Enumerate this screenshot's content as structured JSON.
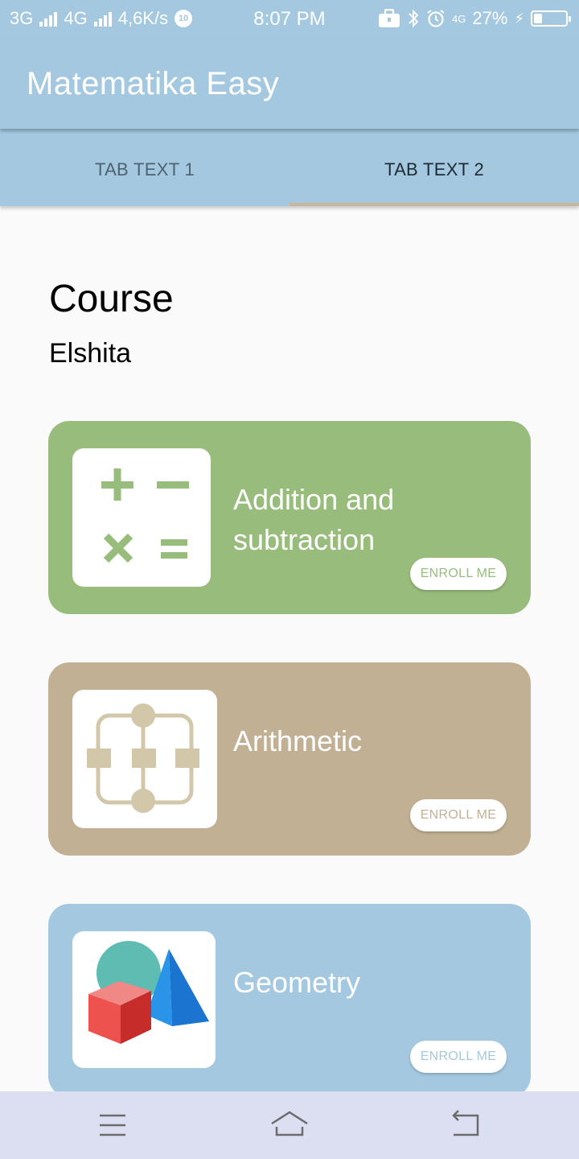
{
  "status_bar": {
    "network1": "3G",
    "network2": "4G",
    "speed": "4,6K/s",
    "notif_badge": "10",
    "time": "8:07 PM",
    "lte": "4G",
    "battery_pct": "27%",
    "battery_level": 0.27
  },
  "app_bar": {
    "title": "Matematika Easy"
  },
  "tabs": [
    {
      "label": "TAB TEXT 1",
      "active": false
    },
    {
      "label": "TAB TEXT 2",
      "active": true
    }
  ],
  "header": {
    "title": "Course",
    "subtitle": "Elshita"
  },
  "courses": [
    {
      "title_line1": "Addition and",
      "title_line2": "subtraction",
      "button": "ENROLL ME",
      "color": "#98bc7b",
      "icon": "math-operators-icon"
    },
    {
      "title": "Arithmetic",
      "button": "ENROLL ME",
      "color": "#c1b093",
      "icon": "flowchart-icon"
    },
    {
      "title": "Geometry",
      "button": "ENROLL ME",
      "color": "#a3c8e0",
      "icon": "geometric-shapes-icon"
    }
  ],
  "nav_bar": {
    "icons": [
      "menu-icon",
      "home-icon",
      "back-icon"
    ]
  },
  "colors": {
    "accent": "#a3c8e0",
    "tab_indicator": "#c9b59a",
    "nav_bar": "#dcdff2",
    "background": "#fafafa"
  }
}
